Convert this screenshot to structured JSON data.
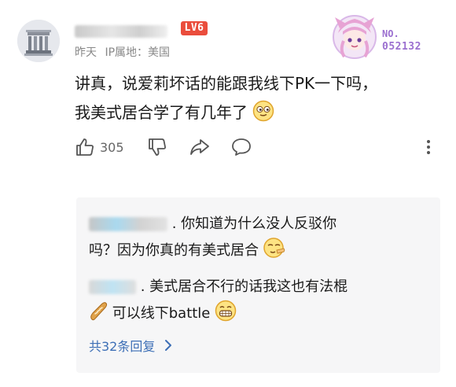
{
  "comment": {
    "level_badge": "LV6",
    "time": "昨天",
    "ip_location": "IP属地：美国",
    "badge_no": "NO.",
    "badge_number": "052132",
    "text_line1": "讲真，说爱莉坏话的能跟我线下PK一下吗，",
    "text_line2": "我美式居合学了有几年了",
    "like_count": "305"
  },
  "replies": [
    {
      "text_line1": ". 你知道为什么没人反驳你",
      "text_line2": "吗？因为你真的有美式居合"
    },
    {
      "text_line1": ". 美式居合不行的话我这也有法棍",
      "text_line2": "可以线下battle"
    }
  ],
  "more_replies": "共32条回复",
  "icons": [
    "thumb-up-icon",
    "thumb-down-icon",
    "share-icon",
    "comment-icon",
    "more-vert-icon",
    "chevron-right-icon"
  ],
  "colors": {
    "level_badge": "#ea4d3c",
    "link": "#3d6fb6",
    "reply_bg": "#f6f6f7",
    "badge_text": "#9b6fd0"
  }
}
